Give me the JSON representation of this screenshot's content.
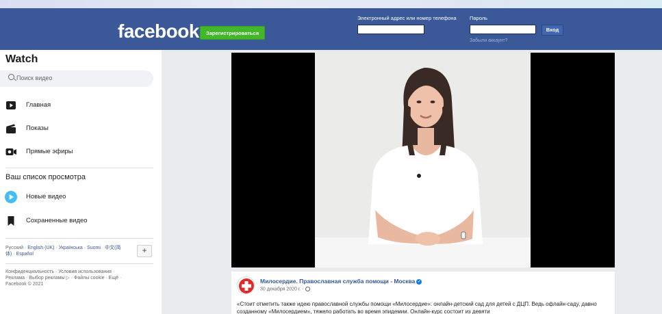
{
  "header": {
    "logo": "facebook",
    "signup_label": "Зарегистрироваться",
    "email_label": "Электронный адрес или номер телефона",
    "password_label": "Пароль",
    "login_label": "Вход",
    "forgot_label": "Забыли аккаунт?"
  },
  "sidebar": {
    "title": "Watch",
    "search_placeholder": "Поиск видео",
    "nav": [
      {
        "label": "Главная",
        "icon": "home-video-icon"
      },
      {
        "label": "Показы",
        "icon": "clapperboard-icon"
      },
      {
        "label": "Прямые эфиры",
        "icon": "live-camera-icon"
      }
    ],
    "section_title": "Ваш список просмотра",
    "watchlist": [
      {
        "label": "Новые видео",
        "icon": "play-circle-icon"
      },
      {
        "label": "Сохраненные видео",
        "icon": "bookmark-icon"
      }
    ],
    "languages": {
      "current": "Русский",
      "links": [
        "English (UK)",
        "Українська",
        "Suomi",
        "中文(简体)",
        "Español"
      ]
    },
    "footer": "Конфиденциальность · Условия использования · Реклама · Выбор рекламы ▷ · Файлы cookie · Ещё · Facebook © 2021"
  },
  "post": {
    "page_name": "Милосердие. Православная служба помощи - Москва",
    "date": "30 декабря 2020 г. ·",
    "text": "«Стоит отметить также идею православной службы помощи «Милосердие»: онлайн-детский сад для детей с ДЦП. Ведь офлайн-саду, давно созданному «Милосердием», тяжело работать во время эпидемии. Онлайн-курс состоит из девяти"
  },
  "colors": {
    "header_bg": "#3b5998",
    "signup_green": "#42b72a",
    "link_blue": "#385898",
    "verified_blue": "#1877f2"
  }
}
